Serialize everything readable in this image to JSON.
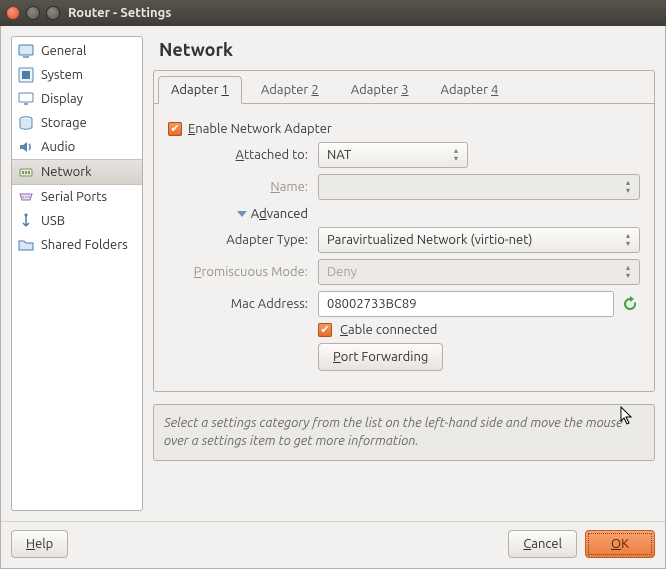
{
  "window": {
    "title": "Router - Settings"
  },
  "sidebar": {
    "items": [
      {
        "label": "General"
      },
      {
        "label": "System"
      },
      {
        "label": "Display"
      },
      {
        "label": "Storage"
      },
      {
        "label": "Audio"
      },
      {
        "label": "Network"
      },
      {
        "label": "Serial Ports"
      },
      {
        "label": "USB"
      },
      {
        "label": "Shared Folders"
      }
    ],
    "selected_index": 5
  },
  "main": {
    "heading": "Network",
    "tabs": [
      {
        "label": "Adapter 1"
      },
      {
        "label": "Adapter 2"
      },
      {
        "label": "Adapter 3"
      },
      {
        "label": "Adapter 4"
      }
    ],
    "active_tab": 0,
    "enable_label": "Enable Network Adapter",
    "enable_checked": true,
    "fields": {
      "attached_to": {
        "label": "Attached to:",
        "value": "NAT"
      },
      "name": {
        "label": "Name:",
        "value": ""
      },
      "advanced": {
        "label": "Advanced"
      },
      "adapter_type": {
        "label": "Adapter Type:",
        "value": "Paravirtualized Network (virtio-net)"
      },
      "promiscuous": {
        "label": "Promiscuous Mode:",
        "value": "Deny"
      },
      "mac_address": {
        "label": "Mac Address:",
        "value": "08002733BC89"
      },
      "cable": {
        "label": "Cable connected",
        "checked": true
      },
      "port_fwd": {
        "label": "Port Forwarding"
      }
    }
  },
  "hint": "Select a settings category from the list on the left-hand side and move the mouse over a settings item to get more information.",
  "buttons": {
    "help": "Help",
    "cancel": "Cancel",
    "ok": "OK"
  }
}
